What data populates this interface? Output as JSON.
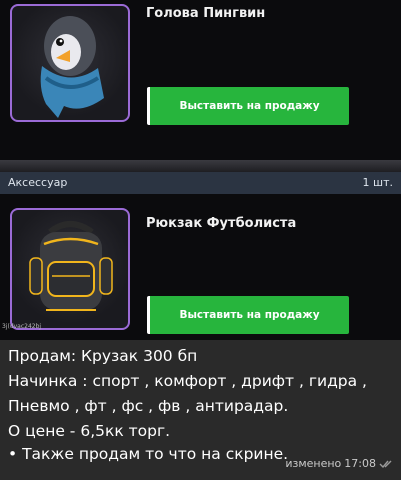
{
  "items": [
    {
      "name": "Голова Пингвин",
      "button_label": "Выставить на продажу",
      "image_icon": "penguin-head-icon"
    },
    {
      "name": "Рюкзак Футболиста",
      "button_label": "Выставить на продажу",
      "image_icon": "backpack-icon",
      "small_id": "3j(dvac242bj"
    }
  ],
  "category": {
    "label": "Аксессуар",
    "quantity": "1 шт."
  },
  "message": {
    "lines": [
      "Продам: Крузак 300 бп",
      "Начинка : спорт , комфорт , дрифт , гидра ,",
      "Пневмо , фт , фс , фв , антирадар.",
      "О цене - 6,5кк торг.",
      " • Также продам то что на скрине."
    ],
    "edited_label": "изменено",
    "time": "17:08",
    "status_icon": "double-check-icon"
  },
  "colors": {
    "button_green": "#27b53d",
    "frame_purple": "#9b6bd6",
    "category_bar": "#2b3442",
    "message_bg": "#2a2a2a"
  }
}
